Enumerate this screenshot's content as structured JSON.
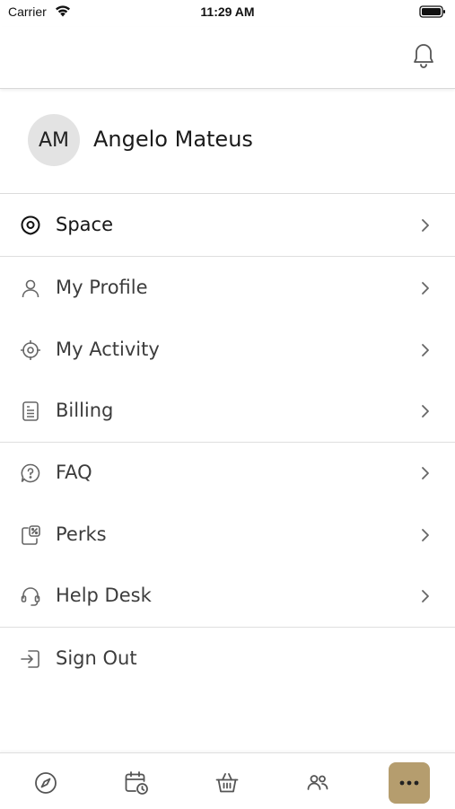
{
  "status_bar": {
    "carrier": "Carrier",
    "time": "11:29 AM"
  },
  "header": {
    "bell_icon": "bell-icon"
  },
  "profile": {
    "initials": "AM",
    "name": "Angelo Mateus"
  },
  "menu": {
    "space": {
      "label": "Space",
      "icon": "location-pin-icon"
    },
    "my_profile": {
      "label": "My Profile",
      "icon": "person-icon"
    },
    "my_activity": {
      "label": "My Activity",
      "icon": "target-icon"
    },
    "billing": {
      "label": "Billing",
      "icon": "document-icon"
    },
    "faq": {
      "label": "FAQ",
      "icon": "question-bubble-icon"
    },
    "perks": {
      "label": "Perks",
      "icon": "discount-tag-icon"
    },
    "help_desk": {
      "label": "Help Desk",
      "icon": "headset-icon"
    },
    "sign_out": {
      "label": "Sign Out",
      "icon": "sign-out-icon"
    }
  },
  "tabbar": {
    "tabs": [
      {
        "icon": "compass-icon",
        "active": false
      },
      {
        "icon": "calendar-clock-icon",
        "active": false
      },
      {
        "icon": "basket-icon",
        "active": false
      },
      {
        "icon": "people-icon",
        "active": false
      },
      {
        "icon": "more-dots-icon",
        "active": true
      }
    ],
    "active_color": "#b59d6e"
  }
}
